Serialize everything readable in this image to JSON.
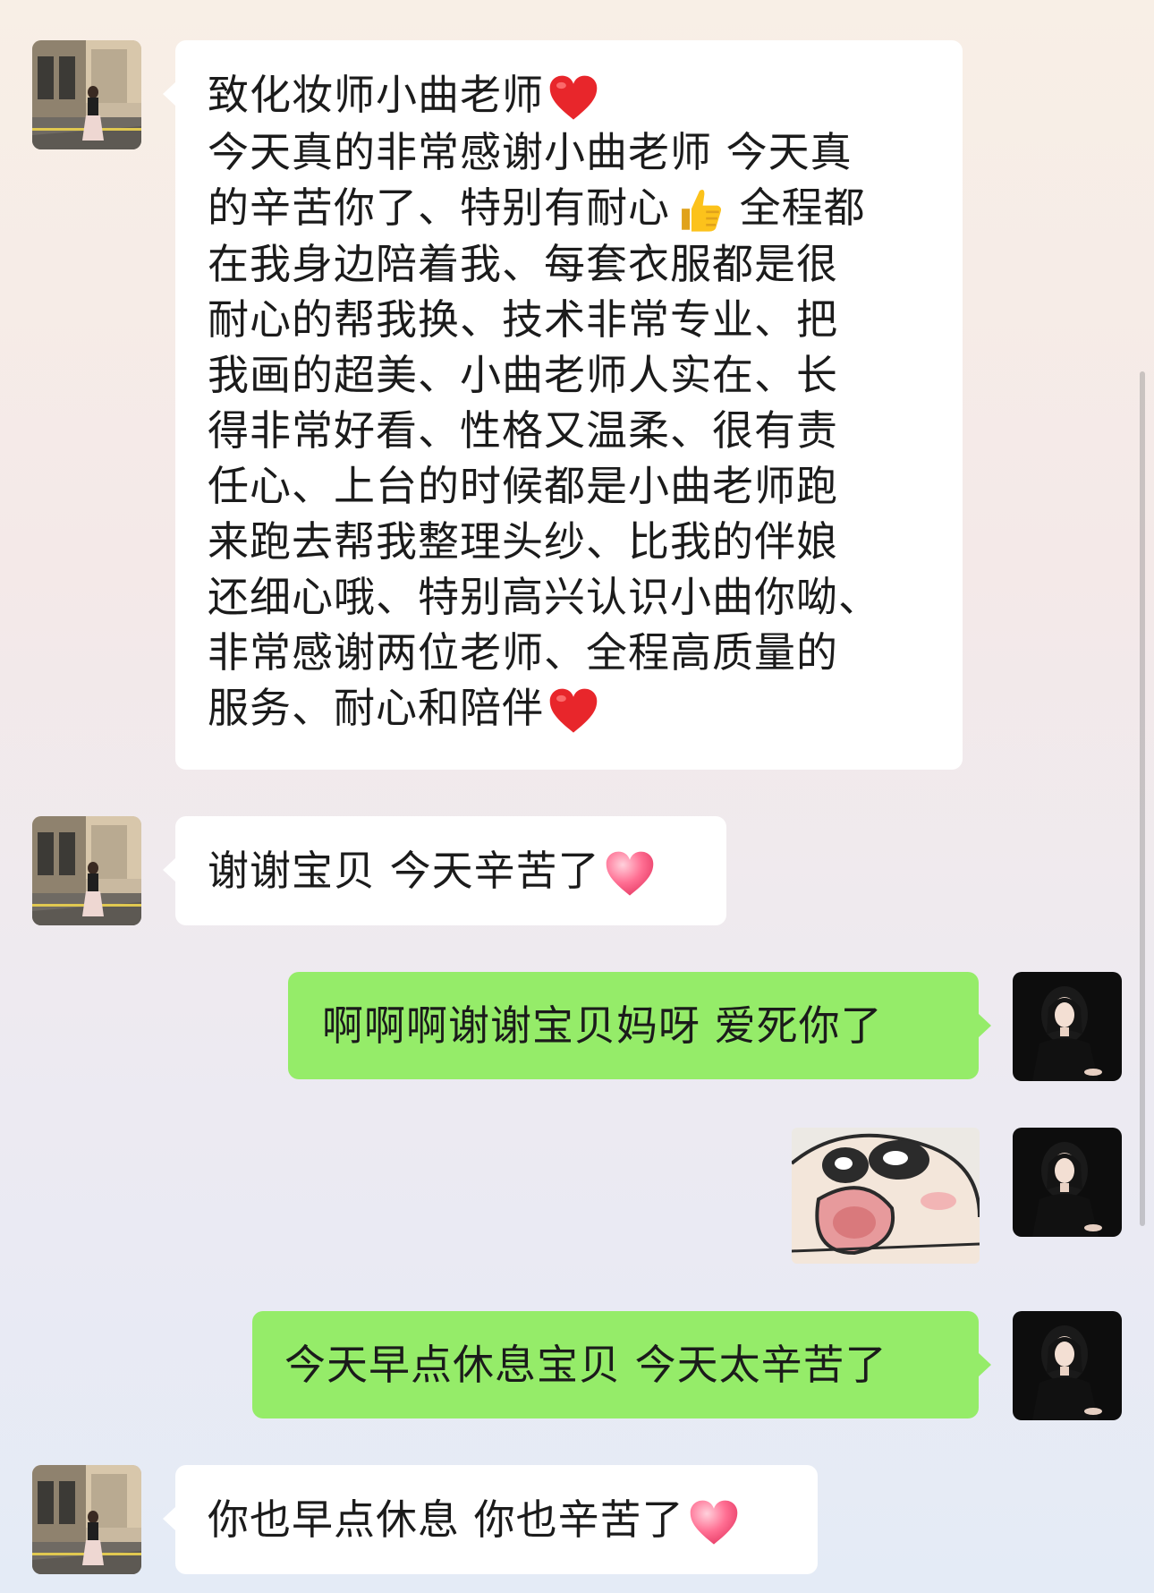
{
  "messages": [
    {
      "sender": "contact",
      "lines": [
        "致化妆师小曲老师",
        "今天真的非常感谢小曲老师 今天真",
        "的辛苦你了、特别有耐心",
        "在我身边陪着我、每套衣服都是很",
        "耐心的帮我换、技术非常专业、把",
        "我画的超美、小曲老师人实在、长",
        "得非常好看、性格又温柔、很有责",
        "任心、上台的时候都是小曲老师跑",
        "来跑去帮我整理头纱、比我的伴娘",
        "还细心哦、特别高兴认识小曲你呦、",
        "非常感谢两位老师、全程高质量的",
        "服务、耐心和陪伴"
      ],
      "line3_suffix": " 全程都",
      "emojis": [
        "red-heart",
        "thumbs-up",
        "red-heart"
      ]
    },
    {
      "sender": "contact",
      "text": "谢谢宝贝 今天辛苦了",
      "emoji": "pink-heart"
    },
    {
      "sender": "me",
      "text": "啊啊啊谢谢宝贝妈呀 爱死你了"
    },
    {
      "sender": "me",
      "type": "sticker",
      "sticker": "crayon-shin-chan-face-sticker"
    },
    {
      "sender": "me",
      "text": "今天早点休息宝贝 今天太辛苦了"
    },
    {
      "sender": "contact",
      "text": "你也早点休息 你也辛苦了",
      "emoji": "pink-heart"
    }
  ],
  "colors": {
    "incoming_bubble": "#ffffff",
    "outgoing_bubble": "#95ec69",
    "text": "#1b1b1b"
  }
}
